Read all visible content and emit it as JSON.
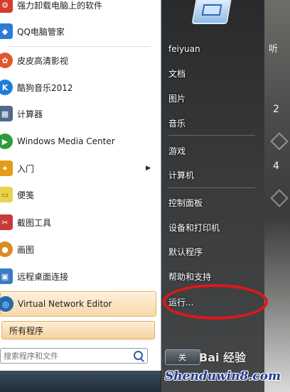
{
  "left_menu": {
    "items": [
      {
        "label": "强力卸载电脑上的软件",
        "icon": "uninstall-icon",
        "color": "#d63b2f"
      },
      {
        "label": "QQ电脑管家",
        "icon": "qq-pcmanager-icon",
        "color": "#2d7bd8"
      },
      {
        "label": "皮皮高清影视",
        "icon": "pipi-video-icon",
        "color": "#e2562b"
      },
      {
        "label": "酷狗音乐2012",
        "icon": "kugou-music-icon",
        "color": "#1f7fd8"
      },
      {
        "label": "计算器",
        "icon": "calculator-icon",
        "color": "#4f6b8b"
      },
      {
        "label": "Windows Media Center",
        "icon": "windows-media-center-icon",
        "color": "#2f9a3a"
      },
      {
        "label": "入门",
        "icon": "getting-started-icon",
        "color": "#e49b1a",
        "has_submenu": true
      },
      {
        "label": "便笺",
        "icon": "sticky-notes-icon",
        "color": "#e8d44d"
      },
      {
        "label": "截图工具",
        "icon": "snipping-tool-icon",
        "color": "#c73a3a"
      },
      {
        "label": "画图",
        "icon": "paint-icon",
        "color": "#d98c23"
      },
      {
        "label": "远程桌面连接",
        "icon": "remote-desktop-icon",
        "color": "#3b7dc4"
      },
      {
        "label": "Virtual Network Editor",
        "icon": "network-editor-icon",
        "color": "#2569b3"
      }
    ],
    "all_programs": "所有程序",
    "search_placeholder": "搜索程序和文件"
  },
  "right_menu": {
    "items": [
      {
        "label": "feiyuan"
      },
      {
        "label": "文档"
      },
      {
        "label": "图片"
      },
      {
        "label": "音乐"
      },
      {
        "label": "游戏"
      },
      {
        "label": "计算机"
      },
      {
        "label": "控制面板"
      },
      {
        "label": "设备和打印机"
      },
      {
        "label": "默认程序"
      },
      {
        "label": "帮助和支持"
      },
      {
        "label": "运行..."
      }
    ],
    "shutdown_label": "关"
  },
  "desktop": {
    "top_text": "听",
    "num_1": "2",
    "num_2": "4"
  },
  "overlay": {
    "baidu_text": "Bai 经验",
    "watermark": "Shenduwin8.com"
  },
  "colors": {
    "highlight": "#f8d9a9",
    "annotation_red": "#e11717"
  }
}
